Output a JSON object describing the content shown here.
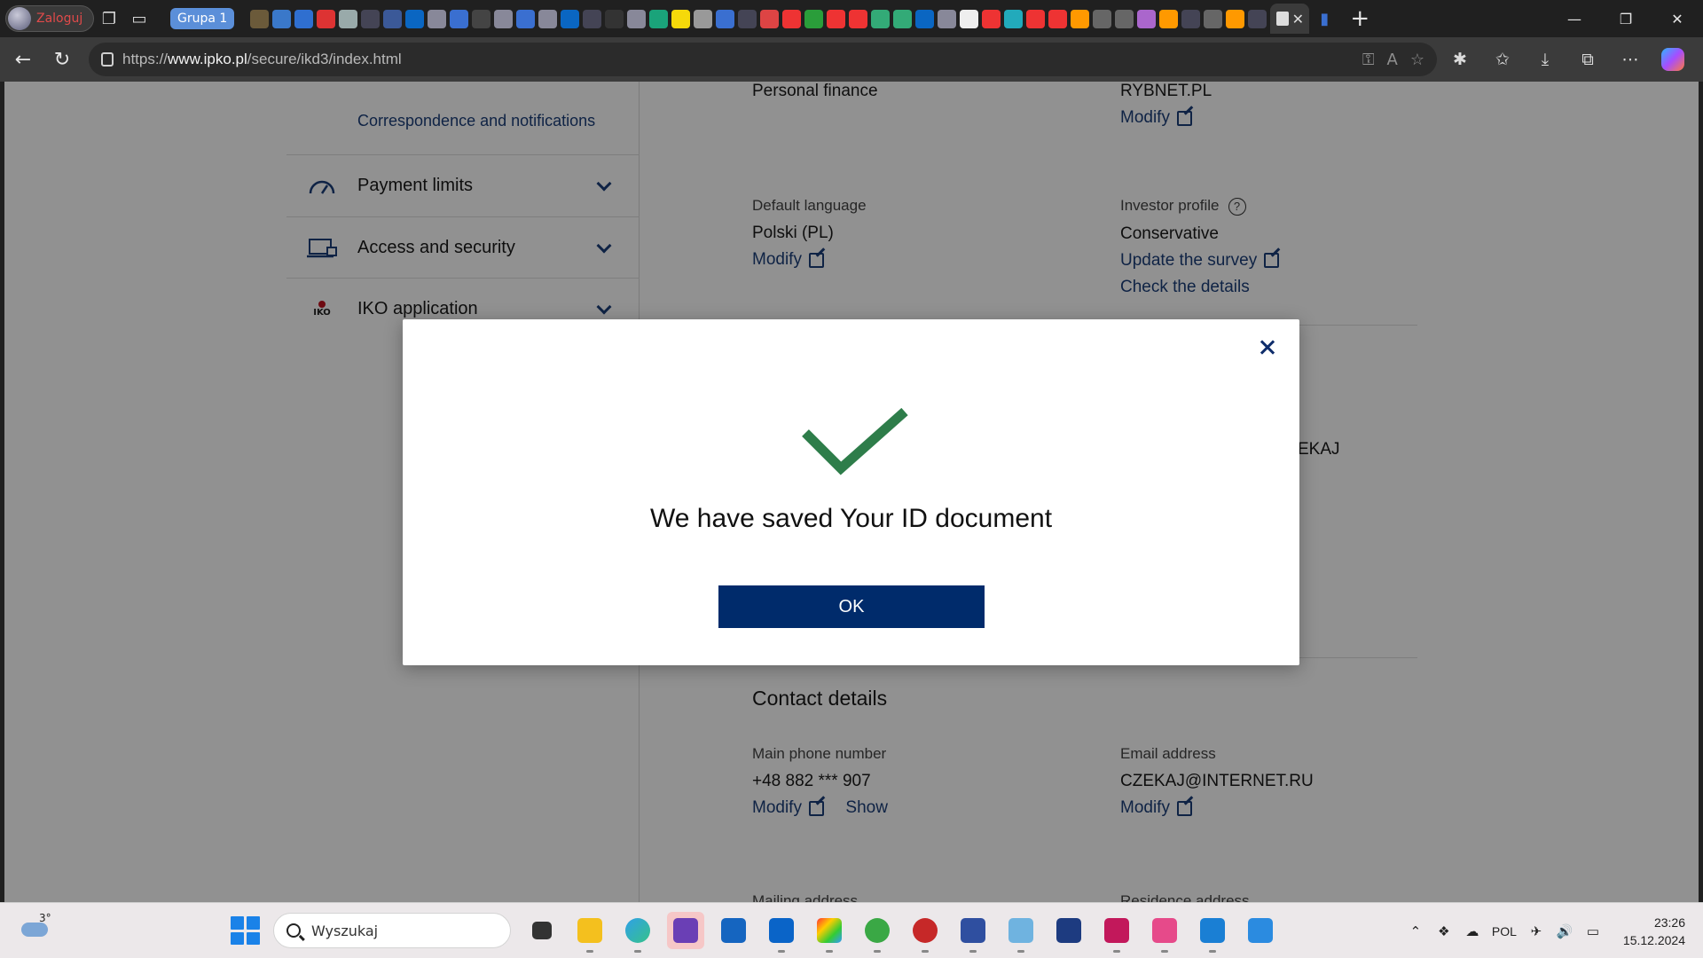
{
  "browser": {
    "profile_label": "Zaloguj",
    "group_label": "Grupa 1",
    "url_prefix": "https://",
    "url_domain": "www.ipko.pl",
    "url_path": "/secure/ikd3/index.html"
  },
  "sidebar": {
    "correspondence_link": "Correspondence and notifications",
    "items": [
      {
        "label": "Payment limits",
        "icon": "gauge-icon"
      },
      {
        "label": "Access and security",
        "icon": "laptop-lock-icon"
      },
      {
        "label": "IKO application",
        "icon": "iko-icon",
        "icon_text": "IKO"
      }
    ]
  },
  "content": {
    "personal_finance": "Personal finance",
    "rybnet": "RYBNET.PL",
    "modify": "Modify",
    "default_language_label": "Default language",
    "default_language_value": "Polski (PL)",
    "investor_profile_label": "Investor profile",
    "investor_profile_value": "Conservative",
    "update_survey": "Update the survey",
    "check_details": "Check the details",
    "partial_name": "EKAJ",
    "contact_title": "Contact details",
    "phone_label": "Main phone number",
    "phone_value": "+48 882 *** 907",
    "show": "Show",
    "email_label": "Email address",
    "email_value": "CZEKAJ@INTERNET.RU",
    "mailing_label": "Mailing address",
    "residence_label": "Residence address"
  },
  "modal": {
    "message": "We have saved Your ID document",
    "ok_label": "OK"
  },
  "taskbar": {
    "temperature": "3°",
    "search_placeholder": "Wyszukaj",
    "language": "POL",
    "time": "23:26",
    "date": "15.12.2024"
  },
  "colors": {
    "brand_navy": "#002b6b",
    "link_blue": "#1c3f7a",
    "check_green": "#2e7d4a"
  }
}
